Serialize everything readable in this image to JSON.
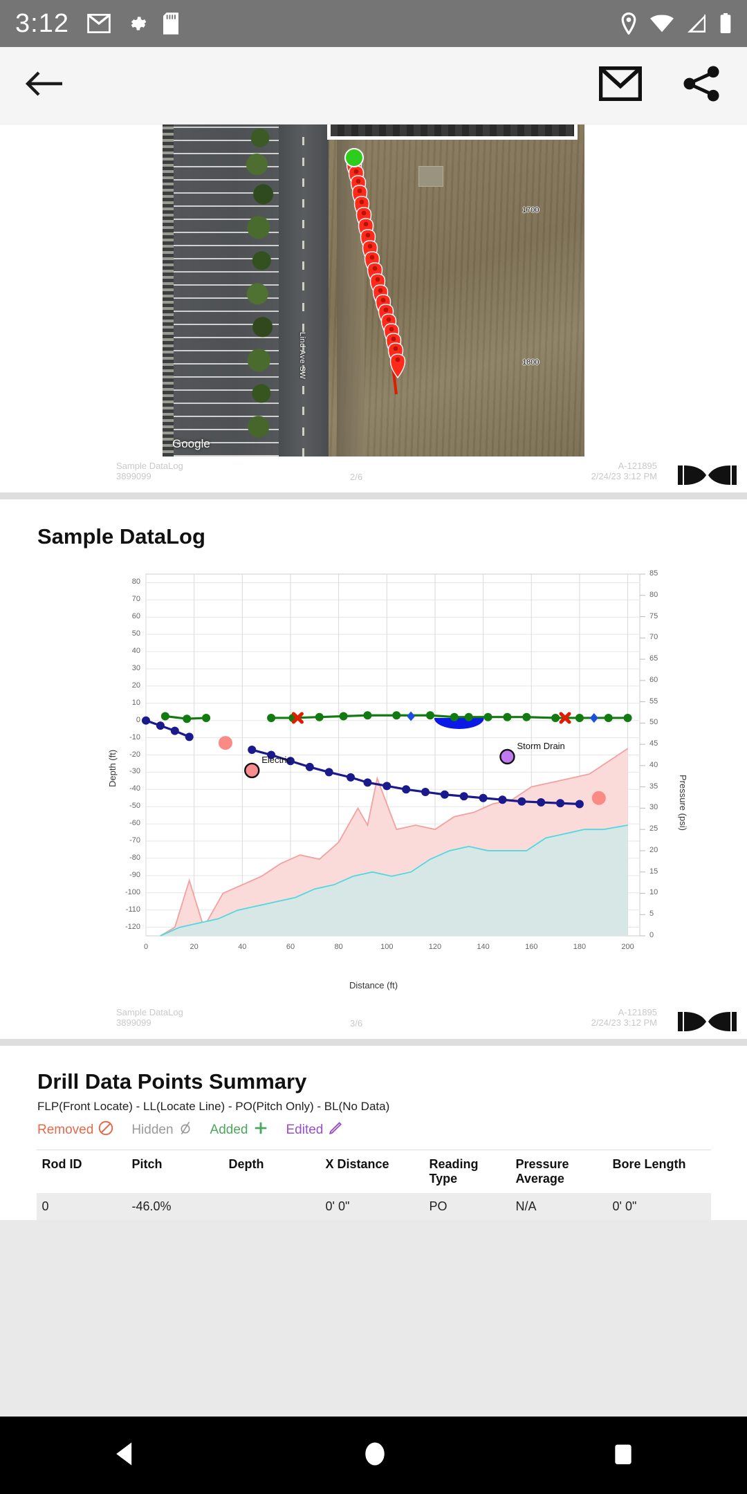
{
  "status_bar": {
    "time": "3:12",
    "left_icons": [
      "gmail-icon",
      "gear-icon",
      "sd-card-icon"
    ],
    "right_icons": [
      "location-icon",
      "wifi-icon",
      "signal-icon",
      "battery-icon"
    ]
  },
  "app_bar": {
    "back_label": "back-arrow",
    "mail_label": "mail-icon",
    "share_label": "share-icon"
  },
  "report_pages": [
    {
      "kind": "map",
      "footer": {
        "name": "Sample DataLog",
        "id": "3899099",
        "page": "2/6",
        "job": "A-121895",
        "timestamp": "2/24/23 3:12 PM",
        "logo": "DCI"
      },
      "map": {
        "attribution": "Google",
        "street_label": "Lind Ave SW",
        "parcel_labels": [
          "1700",
          "1800"
        ],
        "start_marker_color": "#2ecc1c",
        "pin_color": "#ff2a1c",
        "bore_line_color": "#e01b00",
        "pin_count": 20
      }
    },
    {
      "kind": "chart",
      "title": "Sample DataLog",
      "footer": {
        "name": "Sample DataLog",
        "id": "3899099",
        "page": "3/6",
        "job": "A-121895",
        "timestamp": "2/24/23 3:12 PM",
        "logo": "DCI"
      }
    }
  ],
  "chart_data": {
    "type": "line",
    "title": "Sample DataLog",
    "xlabel": "Distance (ft)",
    "ylabel": "Depth (ft)",
    "y2label": "Pressure (psi)",
    "xlim": [
      0,
      205
    ],
    "ylim": [
      -125,
      85
    ],
    "y2lim": [
      0,
      85
    ],
    "xticks": [
      0,
      20,
      40,
      60,
      80,
      100,
      120,
      140,
      160,
      180,
      200
    ],
    "yticks": [
      80,
      70,
      60,
      50,
      40,
      30,
      20,
      10,
      0,
      -10,
      -20,
      -30,
      -40,
      -50,
      -60,
      -70,
      -80,
      -90,
      -100,
      -110,
      -120
    ],
    "y2ticks": [
      0,
      5,
      10,
      15,
      20,
      25,
      30,
      35,
      40,
      45,
      50,
      55,
      60,
      65,
      70,
      75,
      80,
      85
    ],
    "grid": true,
    "legend_position": "none",
    "series": [
      {
        "name": "Depth profile (segment 1)",
        "color": "#1a1a8c",
        "marker": "circle",
        "axis": "left",
        "points": [
          [
            0,
            0
          ],
          [
            6,
            -3
          ],
          [
            12,
            -6
          ],
          [
            18,
            -9.5
          ]
        ]
      },
      {
        "name": "Depth profile (segment 2)",
        "color": "#1a1a8c",
        "marker": "circle",
        "axis": "left",
        "points": [
          [
            44,
            -17
          ],
          [
            52,
            -20
          ],
          [
            60,
            -23.5
          ],
          [
            68,
            -27
          ],
          [
            76,
            -30
          ],
          [
            85,
            -33
          ],
          [
            92,
            -36
          ],
          [
            100,
            -38
          ],
          [
            108,
            -40
          ],
          [
            116,
            -41.5
          ],
          [
            124,
            -43
          ],
          [
            132,
            -44
          ],
          [
            140,
            -45
          ],
          [
            148,
            -46
          ],
          [
            156,
            -47
          ],
          [
            164,
            -47.5
          ],
          [
            172,
            -48
          ],
          [
            180,
            -48.5
          ]
        ]
      },
      {
        "name": "Surface / ground line (segment 1)",
        "color": "#117a11",
        "marker": "circle",
        "axis": "left",
        "points": [
          [
            8,
            2.5
          ],
          [
            17,
            1
          ],
          [
            25,
            1.5
          ]
        ]
      },
      {
        "name": "Surface / ground line (segment 2)",
        "color": "#117a11",
        "marker": "circle",
        "axis": "left",
        "points": [
          [
            52,
            1.5
          ],
          [
            61,
            1.5
          ],
          [
            72,
            2
          ],
          [
            82,
            2.5
          ],
          [
            92,
            3
          ],
          [
            104,
            3
          ],
          [
            118,
            3
          ],
          [
            128,
            2
          ],
          [
            134,
            2
          ],
          [
            142,
            2
          ],
          [
            150,
            2
          ],
          [
            158,
            2
          ],
          [
            170,
            1.5
          ],
          [
            180,
            1.5
          ],
          [
            192,
            1.5
          ],
          [
            200,
            1.5
          ]
        ]
      },
      {
        "name": "Pressure high band",
        "color": "#f4a0a0",
        "fill": "#fbdada",
        "type": "area",
        "axis": "right",
        "points": [
          [
            6,
            0
          ],
          [
            12,
            2
          ],
          [
            18,
            13
          ],
          [
            24,
            2
          ],
          [
            32,
            10
          ],
          [
            40,
            12
          ],
          [
            48,
            14
          ],
          [
            56,
            17
          ],
          [
            64,
            19
          ],
          [
            72,
            18
          ],
          [
            80,
            22
          ],
          [
            88,
            30
          ],
          [
            92,
            26
          ],
          [
            96,
            37
          ],
          [
            104,
            25
          ],
          [
            112,
            26
          ],
          [
            120,
            25
          ],
          [
            128,
            28
          ],
          [
            136,
            29
          ],
          [
            144,
            31
          ],
          [
            152,
            32
          ],
          [
            160,
            35
          ],
          [
            168,
            36
          ],
          [
            176,
            37
          ],
          [
            184,
            38
          ],
          [
            192,
            41
          ],
          [
            200,
            44
          ]
        ]
      },
      {
        "name": "Pressure low band",
        "color": "#4fd8e0",
        "fill": "#d7e7e5",
        "type": "area",
        "axis": "right",
        "points": [
          [
            6,
            0
          ],
          [
            14,
            2
          ],
          [
            22,
            3
          ],
          [
            30,
            4
          ],
          [
            38,
            6
          ],
          [
            46,
            7
          ],
          [
            54,
            8
          ],
          [
            62,
            9
          ],
          [
            70,
            11
          ],
          [
            78,
            12
          ],
          [
            86,
            14
          ],
          [
            94,
            15
          ],
          [
            102,
            14
          ],
          [
            110,
            15
          ],
          [
            118,
            18
          ],
          [
            126,
            20
          ],
          [
            134,
            21
          ],
          [
            142,
            20
          ],
          [
            150,
            20
          ],
          [
            158,
            20
          ],
          [
            166,
            23
          ],
          [
            174,
            24
          ],
          [
            182,
            25
          ],
          [
            190,
            25
          ],
          [
            200,
            26
          ]
        ]
      }
    ],
    "annotations": [
      {
        "label": "Electric",
        "x": 44,
        "y": -29,
        "marker_color": "#f98c8c",
        "marker": "circle-outline"
      },
      {
        "label": "Storm Drain",
        "x": 150,
        "y": -21,
        "marker_color": "#c07af0",
        "marker": "circle-outline"
      }
    ],
    "extra_markers": [
      {
        "name": "utility-1",
        "x": 33,
        "y": -13,
        "color": "#fa8a86",
        "shape": "circle"
      },
      {
        "name": "utility-2",
        "x": 188,
        "y": -45,
        "color": "#fa8a86",
        "shape": "circle"
      },
      {
        "name": "locate-x-1",
        "x": 63,
        "y": 1.5,
        "color": "#e01b00",
        "shape": "x"
      },
      {
        "name": "locate-x-2",
        "x": 174,
        "y": 1.5,
        "color": "#e01b00",
        "shape": "x"
      },
      {
        "name": "locate-diamond-1",
        "x": 110,
        "y": 2.5,
        "color": "#1a4fe0",
        "shape": "diamond"
      },
      {
        "name": "locate-diamond-2",
        "x": 186,
        "y": 1.5,
        "color": "#1a4fe0",
        "shape": "diamond"
      },
      {
        "name": "water-crossing",
        "x": 130,
        "y": -4,
        "color": "#0b19e8",
        "shape": "half-ellipse"
      }
    ]
  },
  "summary": {
    "title": "Drill Data Points Summary",
    "subtitle": "FLP(Front Locate) - LL(Locate Line) - PO(Pitch Only) - BL(No Data)",
    "legend": [
      {
        "label": "Removed",
        "icon": "no-entry-icon",
        "color": "#e8684a"
      },
      {
        "label": "Hidden",
        "icon": "slashed-circle-icon",
        "color": "#9a9a9a"
      },
      {
        "label": "Added",
        "icon": "plus-icon",
        "color": "#4aa85a"
      },
      {
        "label": "Edited",
        "icon": "pencil-icon",
        "color": "#9b4ecb"
      }
    ],
    "columns": [
      "Rod ID",
      "Pitch",
      "Depth",
      "X Distance",
      "Reading Type",
      "Pressure Average",
      "Bore Length"
    ],
    "rows": [
      {
        "rod_id": "0",
        "pitch": "-46.0%",
        "depth": "",
        "x_distance": "0' 0\"",
        "reading_type": "PO",
        "pressure_average": "N/A",
        "bore_length": "0' 0\""
      }
    ]
  },
  "nav_bar": {
    "back": "back-triangle-icon",
    "home": "home-circle-icon",
    "recents": "recents-square-icon"
  }
}
